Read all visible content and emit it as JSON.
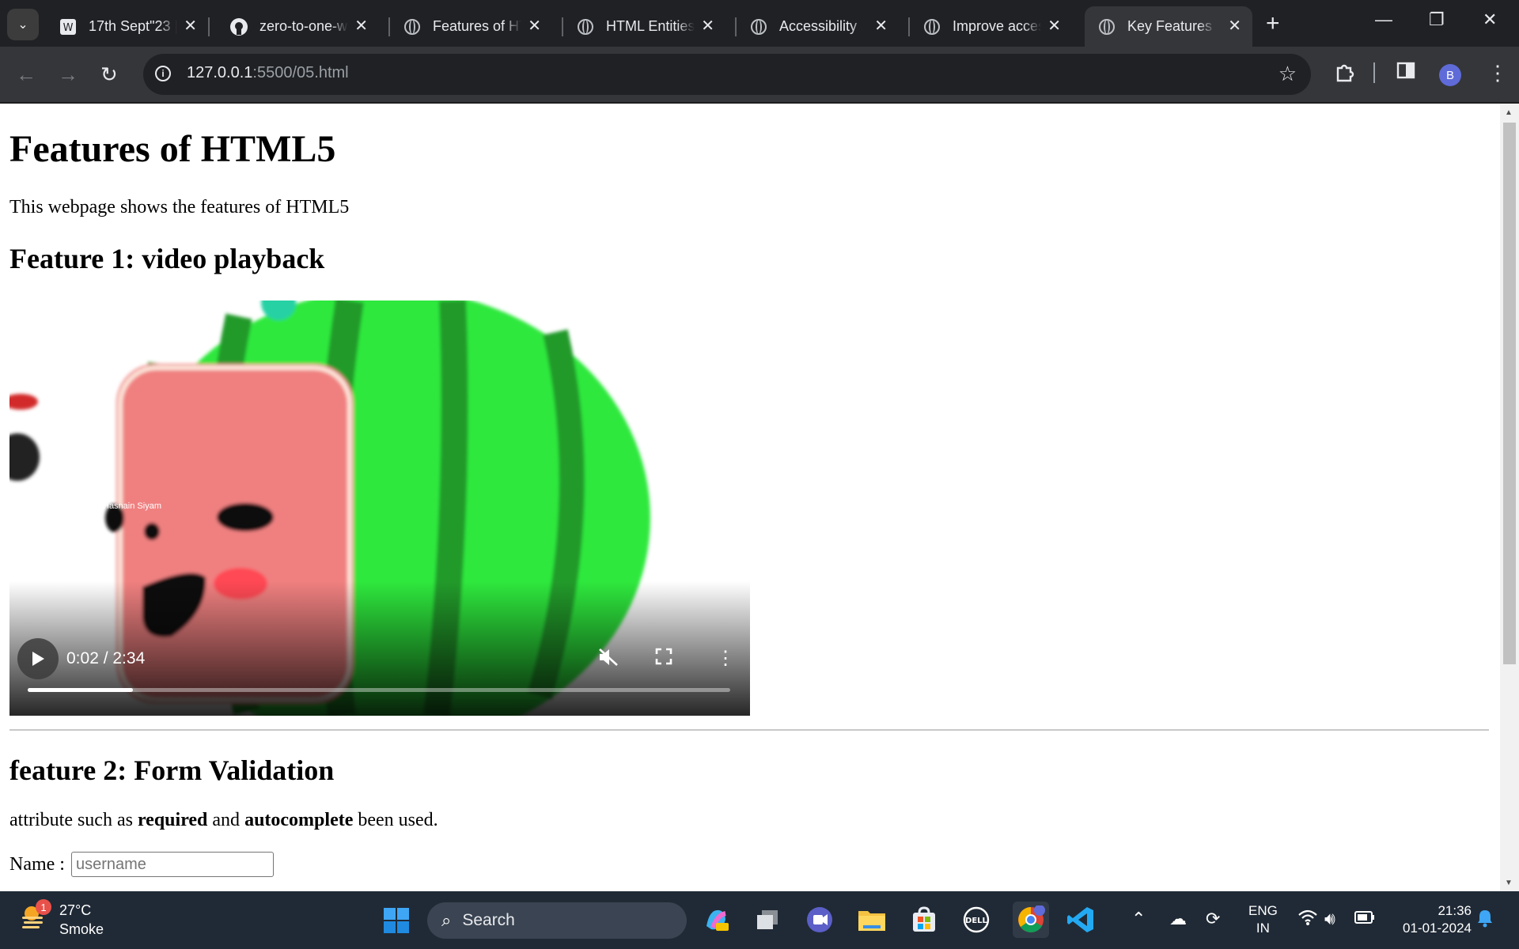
{
  "browser": {
    "tabs": [
      {
        "title": "17th Sept\"23 |",
        "icon": "wordpress-icon"
      },
      {
        "title": "zero-to-one-w",
        "icon": "github-icon"
      },
      {
        "title": "Features of HT",
        "icon": "globe-icon"
      },
      {
        "title": "HTML Entities",
        "icon": "globe-icon"
      },
      {
        "title": "Accessibility",
        "icon": "globe-icon"
      },
      {
        "title": "Improve acces",
        "icon": "globe-icon"
      },
      {
        "title": "Key Features o",
        "icon": "globe-icon",
        "active": true
      }
    ],
    "url_host": "127.0.0.1",
    "url_path": ":5500/05.html",
    "profile_initial": "B"
  },
  "page": {
    "title": "Features of HTML5",
    "intro": "This webpage shows the features of HTML5",
    "feature1_heading": "Feature 1: video playback",
    "video": {
      "time": "0:02 / 2:34",
      "progress": 0.15,
      "watermark": "Hasnain Siyam"
    },
    "feature2_heading": "feature 2: Form Validation",
    "attr_text_before": "attribute such as ",
    "attr_required": "required",
    "attr_and": " and ",
    "attr_autocomplete": "autocomplete",
    "attr_text_after": " been used.",
    "name_label": "Name :",
    "name_placeholder": "username"
  },
  "taskbar": {
    "weather_temp": "27°C",
    "weather_cond": "Smoke",
    "weather_badge": "1",
    "search_label": "Search",
    "lang_line1": "ENG",
    "lang_line2": "IN",
    "time": "21:36",
    "date": "01-01-2024"
  },
  "colors": {
    "chrome_dark": "#202124",
    "chrome_toolbar": "#35363a",
    "taskbar": "#202a36",
    "melon_green": "#2ee83d",
    "melon_face": "#f08080"
  }
}
